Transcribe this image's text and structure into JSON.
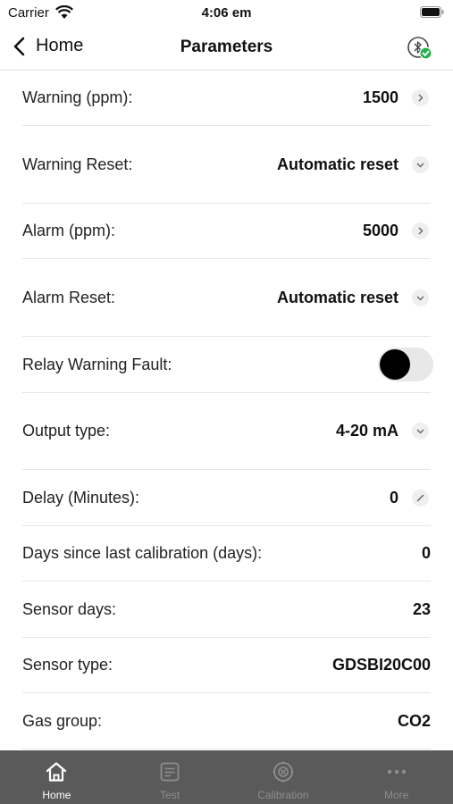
{
  "status_bar": {
    "carrier": "Carrier",
    "time": "4:06 em"
  },
  "nav": {
    "back_label": "Home",
    "title": "Parameters"
  },
  "rows": [
    {
      "label": "Warning (ppm):",
      "value": "1500",
      "accessory": "chevron-right-icon"
    },
    {
      "label": "Warning Reset:",
      "value": "Automatic reset",
      "accessory": "chevron-down-icon"
    },
    {
      "label": "Alarm (ppm):",
      "value": "5000",
      "accessory": "chevron-right-icon"
    },
    {
      "label": "Alarm Reset:",
      "value": "Automatic reset",
      "accessory": "chevron-down-icon"
    },
    {
      "label": "Relay Warning Fault:",
      "toggle_on": false
    },
    {
      "label": "Output type:",
      "value": "4-20 mA",
      "accessory": "chevron-down-icon"
    },
    {
      "label": "Delay (Minutes):",
      "value": "0",
      "accessory": "pencil-icon"
    },
    {
      "label": "Days since last calibration (days):",
      "value": "0"
    },
    {
      "label": "Sensor days:",
      "value": "23"
    },
    {
      "label": "Sensor type:",
      "value": "GDSBI20C00"
    },
    {
      "label": "Gas group:",
      "value": "CO2"
    }
  ],
  "tabs": [
    {
      "label": "Home",
      "icon": "home-icon",
      "active": true
    },
    {
      "label": "Test",
      "icon": "test-icon",
      "active": false
    },
    {
      "label": "Calibration",
      "icon": "calibration-icon",
      "active": false
    },
    {
      "label": "More",
      "icon": "more-icon",
      "active": false
    }
  ],
  "colors": {
    "tab_bar": "#5a5a5a",
    "bluetooth_ok": "#1fb24a",
    "toggle_knob": "#000000"
  }
}
